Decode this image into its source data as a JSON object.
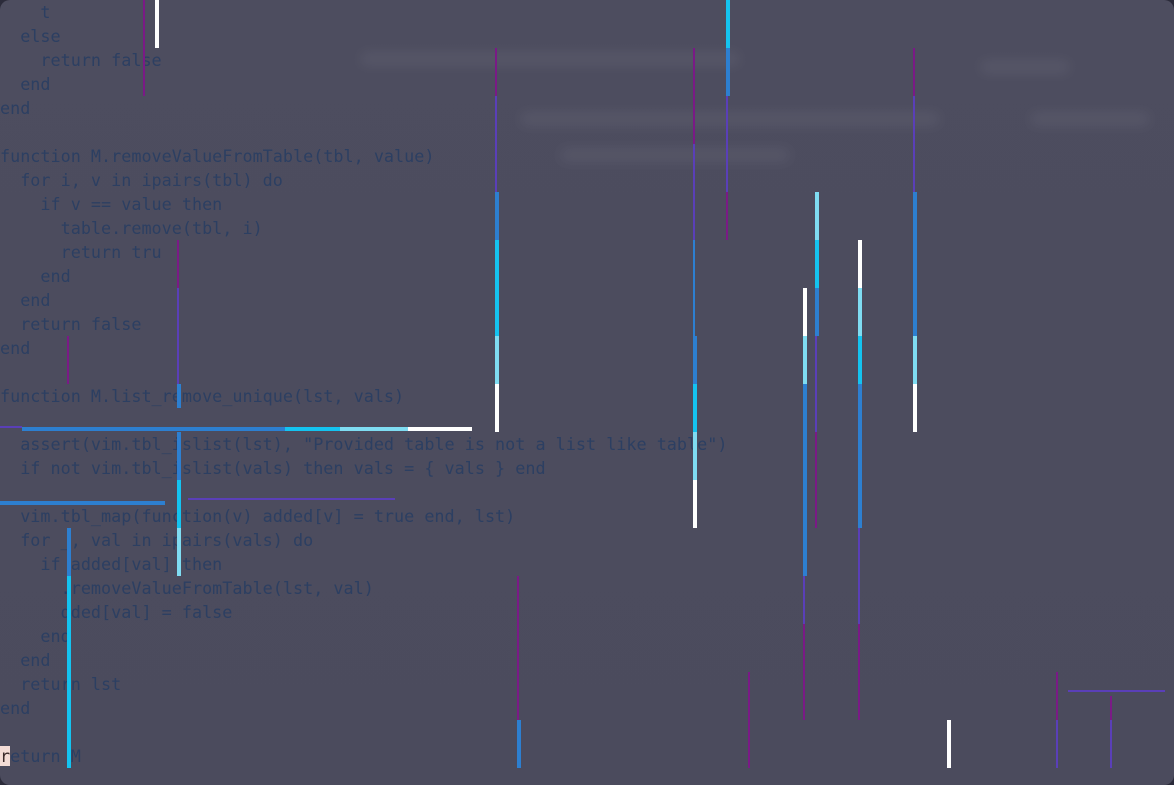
{
  "editor": {
    "lines": [
      "    t",
      "  else",
      "    return false",
      "  end",
      "end",
      "",
      "function M.removeValueFromTable(tbl, value)",
      "  for i, v in ipairs(tbl) do",
      "    if v == value then",
      "      table.remove(tbl, i)",
      "      return tru",
      "    end",
      "  end",
      "  return false",
      "end",
      "",
      "function M.list_remove_unique(lst, vals)",
      "",
      "  assert(vim.tbl_islist(lst), \"Provided table is not a list like table\")",
      "  if not vim.tbl_islist(vals) then vals = { vals } end",
      "",
      "  vim.tbl_map(function(v) added[v] = true end, lst)",
      "  for _, val in ipairs(vals) do",
      "    if added[val] then",
      "      .removeValueFromTable(lst, val)",
      "      dded[val] = false",
      "    end",
      "  end",
      "  return lst",
      "end",
      "",
      "return M"
    ]
  },
  "colors": {
    "background": "#4c4c5e",
    "code_text": "#2c3f62",
    "keyword": "#203d84",
    "cursor": "#f3dcd6",
    "rain_white": "#ffffff",
    "rain_cyan": "#14c3f0",
    "rain_lightcyan": "#7fdcf2",
    "rain_blue": "#2d7fd0",
    "rain_indigo": "#5a3fb8",
    "rain_purple": "#7a1a86"
  },
  "effects": {
    "overlay": "digital-rain-streaks"
  }
}
